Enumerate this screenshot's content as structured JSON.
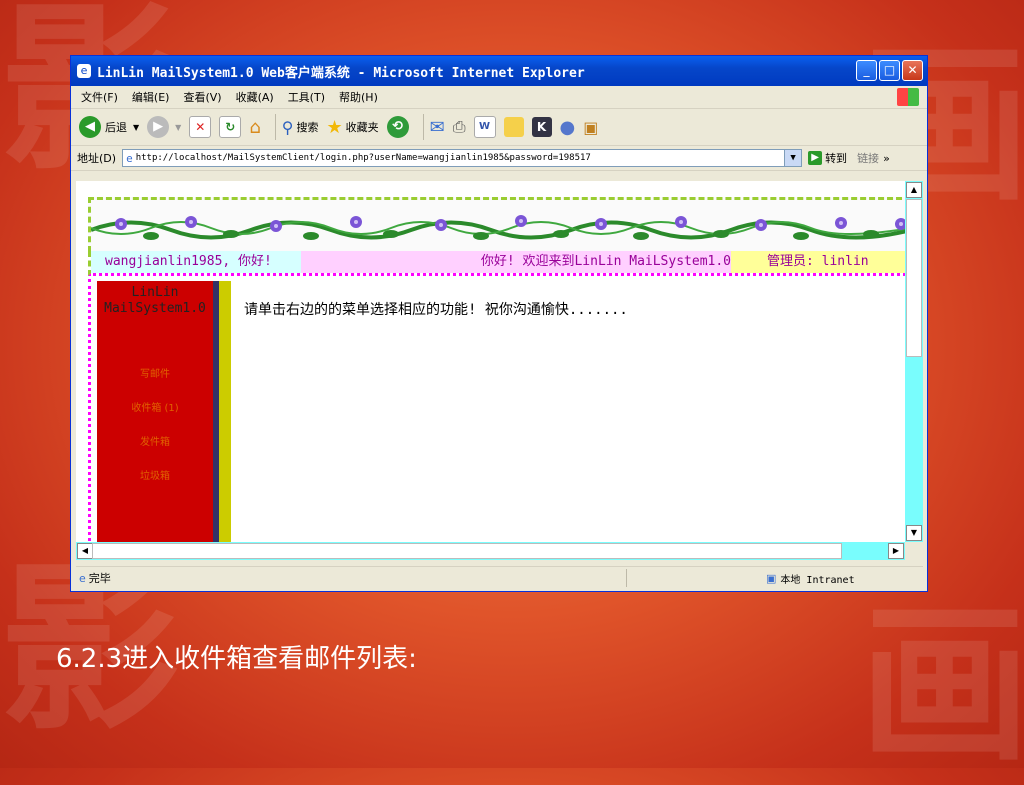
{
  "window": {
    "title": "LinLin MailSystem1.0 Web客户端系统 - Microsoft Internet Explorer",
    "controls": {
      "minimize": "_",
      "maximize": "□",
      "close": "✕"
    }
  },
  "menu": [
    "文件(F)",
    "编辑(E)",
    "查看(V)",
    "收藏(A)",
    "工具(T)",
    "帮助(H)"
  ],
  "toolbar": {
    "back": "后退",
    "search": "搜索",
    "favorites": "收藏夹"
  },
  "address": {
    "label": "地址(D)",
    "url": "http://localhost/MailSystemClient/login.php?userName=wangjianlin1985&password=198517",
    "go": "转到",
    "links": "链接"
  },
  "page": {
    "greeting_user": "wangjianlin1985, 你好!",
    "welcome_text": "你好! 欢迎来到LinLin MaiLSystem1.0",
    "admin_text": "管理员: linlin",
    "system_name_line1": "LinLin",
    "system_name_line2": "MailSystem1.0",
    "menu_items": [
      "写邮件",
      "收件箱 (1)",
      "发件箱",
      "垃圾箱"
    ],
    "instruction": "请单击右边的的菜单选择相应的功能! 祝你沟通愉快......."
  },
  "status": {
    "left": "完毕",
    "zone": "本地 Intranet"
  },
  "caption": "6.2.3进入收件箱查看邮件列表:",
  "colors": {
    "slide_bg": "#e0542a",
    "titlebar": "#0646c9",
    "menu_red": "#cc0000",
    "scroll_cyan": "#79fdfd"
  }
}
